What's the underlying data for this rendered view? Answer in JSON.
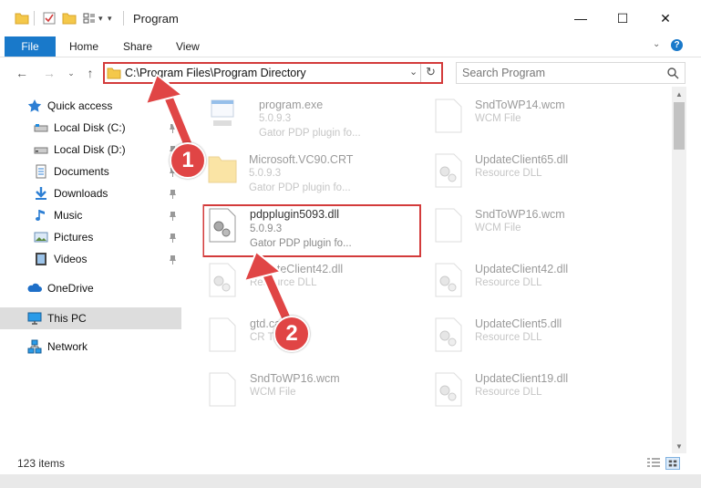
{
  "window": {
    "title": "Program",
    "minimize": "—",
    "maximize": "☐",
    "close": "✕"
  },
  "ribbon": {
    "file": "File",
    "tabs": [
      "Home",
      "Share",
      "View"
    ],
    "help": "?"
  },
  "address": {
    "path": "C:\\Program Files\\Program Directory",
    "search_placeholder": "Search Program"
  },
  "nav": {
    "items": [
      {
        "label": "Quick access",
        "icon": "star-icon"
      },
      {
        "label": "Local Disk (C:)",
        "icon": "drive-icon"
      },
      {
        "label": "Local Disk (D:)",
        "icon": "drive-icon"
      },
      {
        "label": "Documents",
        "icon": "documents-icon"
      },
      {
        "label": "Downloads",
        "icon": "downloads-icon"
      },
      {
        "label": "Music",
        "icon": "music-icon"
      },
      {
        "label": "Pictures",
        "icon": "pictures-icon"
      },
      {
        "label": "Videos",
        "icon": "videos-icon"
      },
      {
        "label": "OneDrive",
        "icon": "onedrive-icon"
      },
      {
        "label": "This PC",
        "icon": "computer-icon"
      },
      {
        "label": "Network",
        "icon": "network-icon"
      }
    ]
  },
  "files": {
    "left": [
      {
        "name": "program.exe",
        "line2": "5.0.9.3",
        "line3": "Gator PDP plugin fo...",
        "icon": "exe"
      },
      {
        "name": "Microsoft.VC90.CRT",
        "line2": "5.0.9.3",
        "line3": "Gator PDP plugin fo...",
        "icon": "folder"
      },
      {
        "name": "pdpplugin5093.dll",
        "line2": "5.0.9.3",
        "line3": "Gator PDP plugin fo...",
        "icon": "dll"
      },
      {
        "name": "UpdateClient42.dll",
        "line2": "Resource DLL",
        "line3": "",
        "icon": "dll"
      },
      {
        "name": "gtd.cat",
        "line2": "CR T",
        "line3": "",
        "icon": "doc"
      },
      {
        "name": "SndToWP16.wcm",
        "line2": "WCM File",
        "line3": "",
        "icon": "doc"
      }
    ],
    "right": [
      {
        "name": "SndToWP14.wcm",
        "line2": "WCM File",
        "icon": "doc"
      },
      {
        "name": "UpdateClient65.dll",
        "line2": "Resource DLL",
        "icon": "dll"
      },
      {
        "name": "SndToWP16.wcm",
        "line2": "WCM File",
        "icon": "doc"
      },
      {
        "name": "UpdateClient42.dll",
        "line2": "Resource DLL",
        "icon": "dll"
      },
      {
        "name": "UpdateClient5.dll",
        "line2": "Resource DLL",
        "icon": "dll"
      },
      {
        "name": "UpdateClient19.dll",
        "line2": "Resource DLL",
        "icon": "dll"
      }
    ]
  },
  "status": {
    "count": "123 items"
  },
  "annotations": {
    "step1": "1",
    "step2": "2"
  },
  "colors": {
    "accent": "#1979ca",
    "highlight": "#d33b3b"
  }
}
